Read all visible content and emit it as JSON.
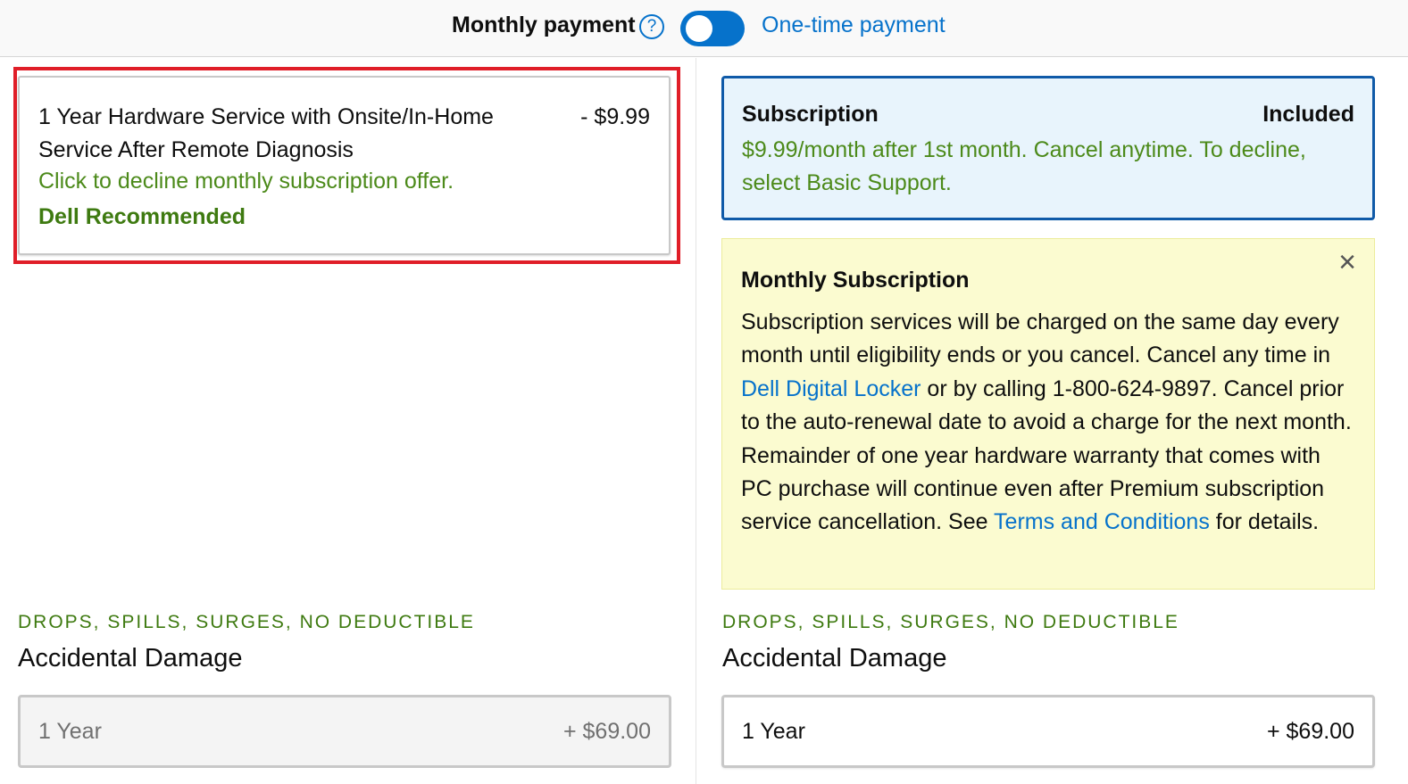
{
  "payment_toggle": {
    "monthly_label": "Monthly payment",
    "help_icon": "?",
    "onetime_label": "One-time payment",
    "accent": "#0672cb"
  },
  "left": {
    "option_card": {
      "title": "1 Year Hardware Service with Onsite/In-Home Service After Remote Diagnosis",
      "price": "- $9.99",
      "decline_text": "Click to decline monthly subscription offer.",
      "recommended": "Dell Recommended"
    },
    "accidental": {
      "eyebrow": "DROPS, SPILLS, SURGES, NO DEDUCTIBLE",
      "title": "Accidental Damage",
      "term": "1 Year",
      "price": "+ $69.00"
    }
  },
  "right": {
    "subscription_card": {
      "title": "Subscription",
      "status": "Included",
      "description": "$9.99/month after 1st month. Cancel anytime. To decline, select Basic Support."
    },
    "info_box": {
      "heading": "Monthly Subscription",
      "body_part1": "Subscription services will be charged on the same day every month until eligibility ends or you cancel.  Cancel any time in ",
      "link1": "Dell Digital Locker",
      "body_part2": " or by calling 1-800-624-9897. Cancel prior to the auto-renewal date to avoid a charge for the next month. Remainder of one year hardware warranty that comes with PC purchase will continue even after Premium subscription service cancellation. See ",
      "link2": "Terms and Conditions",
      "body_part3": " for details.",
      "close_icon": "×"
    },
    "accidental": {
      "eyebrow": "DROPS, SPILLS, SURGES, NO DEDUCTIBLE",
      "title": "Accidental Damage",
      "term": "1 Year",
      "price": "+ $69.00"
    }
  }
}
